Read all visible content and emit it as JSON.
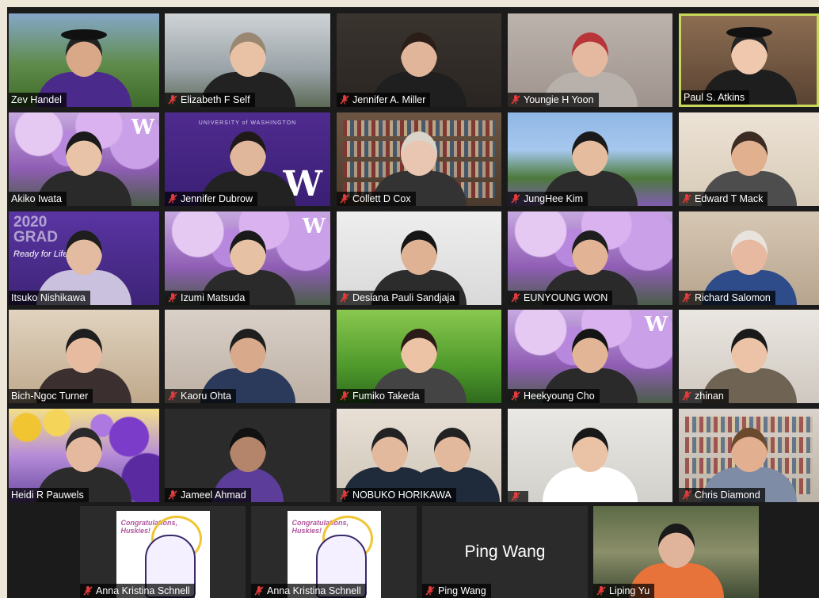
{
  "participants": [
    {
      "name": "Zev Handel",
      "muted": false
    },
    {
      "name": "Elizabeth F Self",
      "muted": true
    },
    {
      "name": "Jennifer A. Miller",
      "muted": true
    },
    {
      "name": "Youngie H Yoon",
      "muted": true
    },
    {
      "name": "Paul S. Atkins",
      "muted": false,
      "active_speaker": true
    },
    {
      "name": "Akiko Iwata",
      "muted": false
    },
    {
      "name": "Jennifer Dubrow",
      "muted": true
    },
    {
      "name": "Collett D Cox",
      "muted": true
    },
    {
      "name": "JungHee Kim",
      "muted": true
    },
    {
      "name": "Edward T Mack",
      "muted": true
    },
    {
      "name": "Itsuko Nishikawa",
      "muted": false
    },
    {
      "name": "Izumi Matsuda",
      "muted": true
    },
    {
      "name": "Desiana Pauli Sandjaja",
      "muted": true
    },
    {
      "name": "EUNYOUNG WON",
      "muted": true
    },
    {
      "name": "Richard Salomon",
      "muted": true
    },
    {
      "name": "Bich-Ngoc Turner",
      "muted": false
    },
    {
      "name": "Kaoru Ohta",
      "muted": true
    },
    {
      "name": "Fumiko Takeda",
      "muted": true
    },
    {
      "name": "Heekyoung Cho",
      "muted": true
    },
    {
      "name": "zhinan",
      "muted": true
    },
    {
      "name": "Heidi R Pauwels",
      "muted": false
    },
    {
      "name": "Jameel Ahmad",
      "muted": true
    },
    {
      "name": "NOBUKO HORIKAWA",
      "muted": true
    },
    {
      "name": "",
      "muted": true
    },
    {
      "name": "Chris Diamond",
      "muted": true
    },
    {
      "name": "Anna Kristina Schnell",
      "muted": true
    },
    {
      "name": "Anna Kristina Schnell",
      "muted": true
    },
    {
      "name": "Ping Wang",
      "muted": true
    },
    {
      "name": "Liping Yu",
      "muted": true
    }
  ],
  "video_off_display_name": "Ping Wang",
  "backgrounds": {
    "zev": "#5e8b4a",
    "purple": "#4a2a8a",
    "blossom": "#b98ad6",
    "office": "#d7cfc3",
    "shelf": "#6d5542"
  },
  "overlay_text": {
    "uw_small": "UNIVERSITY of WASHINGTON",
    "w_logo": "W",
    "grad_text": "2020 GRAD",
    "grad_script": "Ready for Life!",
    "congrats": "Congratulations, Huskies!"
  },
  "icons": {
    "muted": "muted-mic-icon"
  }
}
